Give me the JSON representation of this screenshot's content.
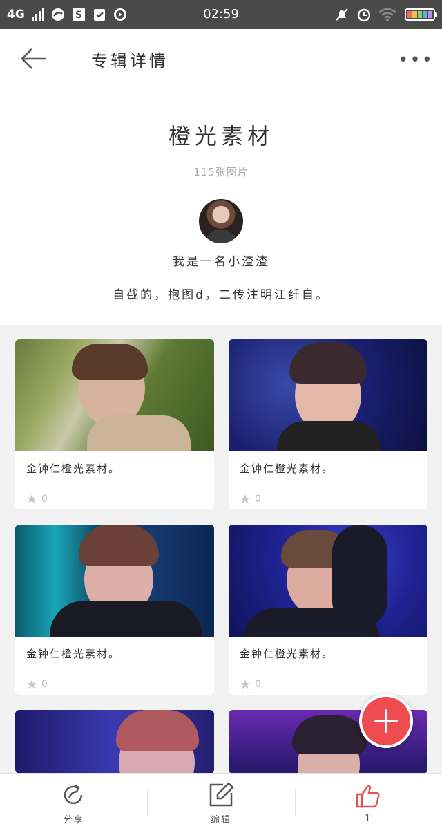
{
  "status_bar": {
    "network": "4G",
    "time": "02:59"
  },
  "header": {
    "title": "专辑详情"
  },
  "album": {
    "title": "橙光素材",
    "count": "115张图片",
    "author": "我是一名小渣渣",
    "description": "自截的，抱图d，二传注明江纤自。"
  },
  "cards": [
    {
      "caption": "金钟仁橙光素材。",
      "likes": "0"
    },
    {
      "caption": "金钟仁橙光素材。",
      "likes": "0"
    },
    {
      "caption": "金钟仁橙光素材。",
      "likes": "0"
    },
    {
      "caption": "金钟仁橙光素材。",
      "likes": "0"
    },
    {
      "caption": "",
      "likes": ""
    },
    {
      "caption": "",
      "likes": ""
    }
  ],
  "bottom_bar": {
    "share_label": "分享",
    "edit_label": "编辑",
    "like_count": "1"
  },
  "colors": {
    "accent": "#ef4c52",
    "status_bar": "#4a4a4a"
  },
  "icons": [
    "back-arrow-icon",
    "more-icon",
    "star-icon",
    "plus-icon",
    "share-icon",
    "edit-icon",
    "thumbs-up-icon"
  ]
}
